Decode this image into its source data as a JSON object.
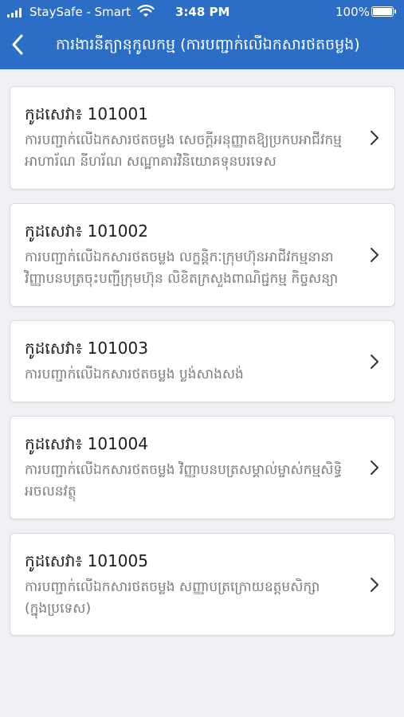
{
  "status_bar": {
    "carrier": "StaySafe - Smart",
    "time": "3:48 PM",
    "battery": "100%",
    "battery_level": 1.0
  },
  "header": {
    "title": "ការងារនីត្យានុកូលកម្ម (ការបញ្ជាក់លើឯកសារថតចម្លង)",
    "back_icon": "chevron-left-icon",
    "background": "#2c6ec6"
  },
  "services": [
    {
      "code": "កូដសេវា៖ 101001",
      "description": "ការបញ្ជាក់លើឯកសារថតចម្លង សេចក្តីអនុញ្ញាតឱ្យប្រកបអាជីវកម្ម អាហារ័ណ នីហរ័ណ សណ្ឋាគារវិនិយោគទុនបរទេស",
      "note": ""
    },
    {
      "code": "កូដសេវា៖ 101002",
      "description": "ការបញ្ជាក់លើឯកសារថតចម្លង លក្ខន្តិកៈក្រុមហ៊ុនអាជីវកម្មនានា វិញ្ញាបនបត្រចុះបញ្ជីក្រុមហ៊ុន លិខិតក្រសួងពាណិជ្ជកម្ម កិច្ចសន្យា",
      "note": ""
    },
    {
      "code": "កូដសេវា៖ 101003",
      "description": "ការបញ្ជាក់លើឯកសារថតចម្លង ប្លង់សាងសង់",
      "note": ""
    },
    {
      "code": "កូដសេវា៖ 101004",
      "description": "ការបញ្ជាក់លើឯកសារថតចម្លង វិញ្ញាបនបត្រសម្គាល់ម្ចាស់កម្មសិទ្ធិអចលនវត្ថុ",
      "note": ""
    },
    {
      "code": "កូដសេវា៖ 101005",
      "description": "ការបញ្ជាក់លើឯកសារថតចម្លង សញ្ញាបត្រក្រោយឧត្តមសិក្សា",
      "note": "(ក្នុងប្រទេស)"
    }
  ]
}
